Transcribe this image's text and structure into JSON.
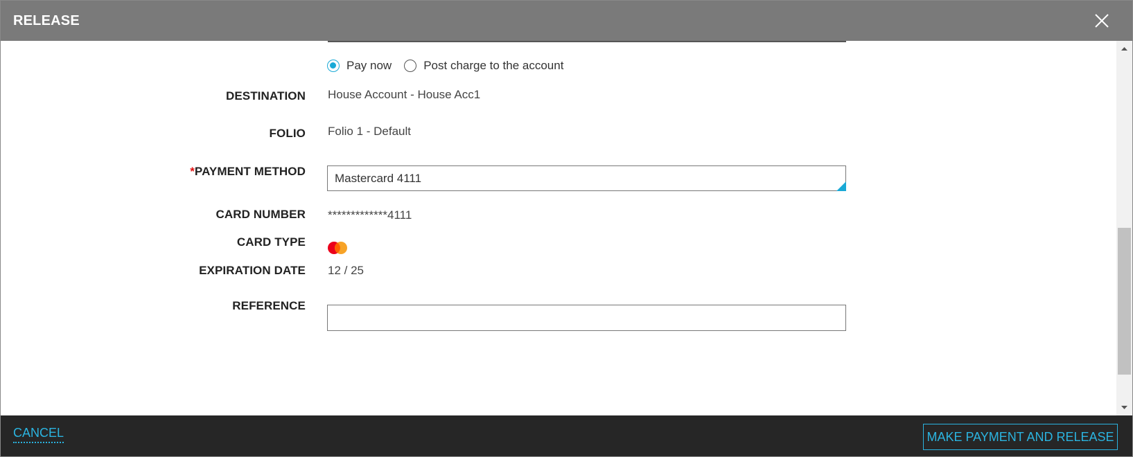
{
  "dialog": {
    "title": "RELEASE",
    "close_icon": "close-icon"
  },
  "payment_option": {
    "options": [
      {
        "label": "Pay now",
        "selected": true
      },
      {
        "label": "Post charge to the account",
        "selected": false
      }
    ]
  },
  "fields": {
    "destination": {
      "label": "DESTINATION",
      "value": "House Account - House Acc1"
    },
    "folio": {
      "label": "FOLIO",
      "value": "Folio 1 - Default"
    },
    "payment_method": {
      "required_marker": "*",
      "label": "PAYMENT METHOD",
      "value": "Mastercard 4111"
    },
    "card_number": {
      "label": "CARD NUMBER",
      "value": "*************4111"
    },
    "card_type": {
      "label": "CARD TYPE",
      "icon": "mastercard-icon"
    },
    "expiration_date": {
      "label": "EXPIRATION DATE",
      "value": "12 / 25"
    },
    "reference": {
      "label": "REFERENCE",
      "value": ""
    }
  },
  "footer": {
    "cancel_label": "CANCEL",
    "primary_label": "MAKE PAYMENT AND RELEASE"
  },
  "colors": {
    "accent": "#19a9d6",
    "title_bar": "#7a7a7a",
    "footer_bg": "#262626",
    "required": "#e01010"
  }
}
